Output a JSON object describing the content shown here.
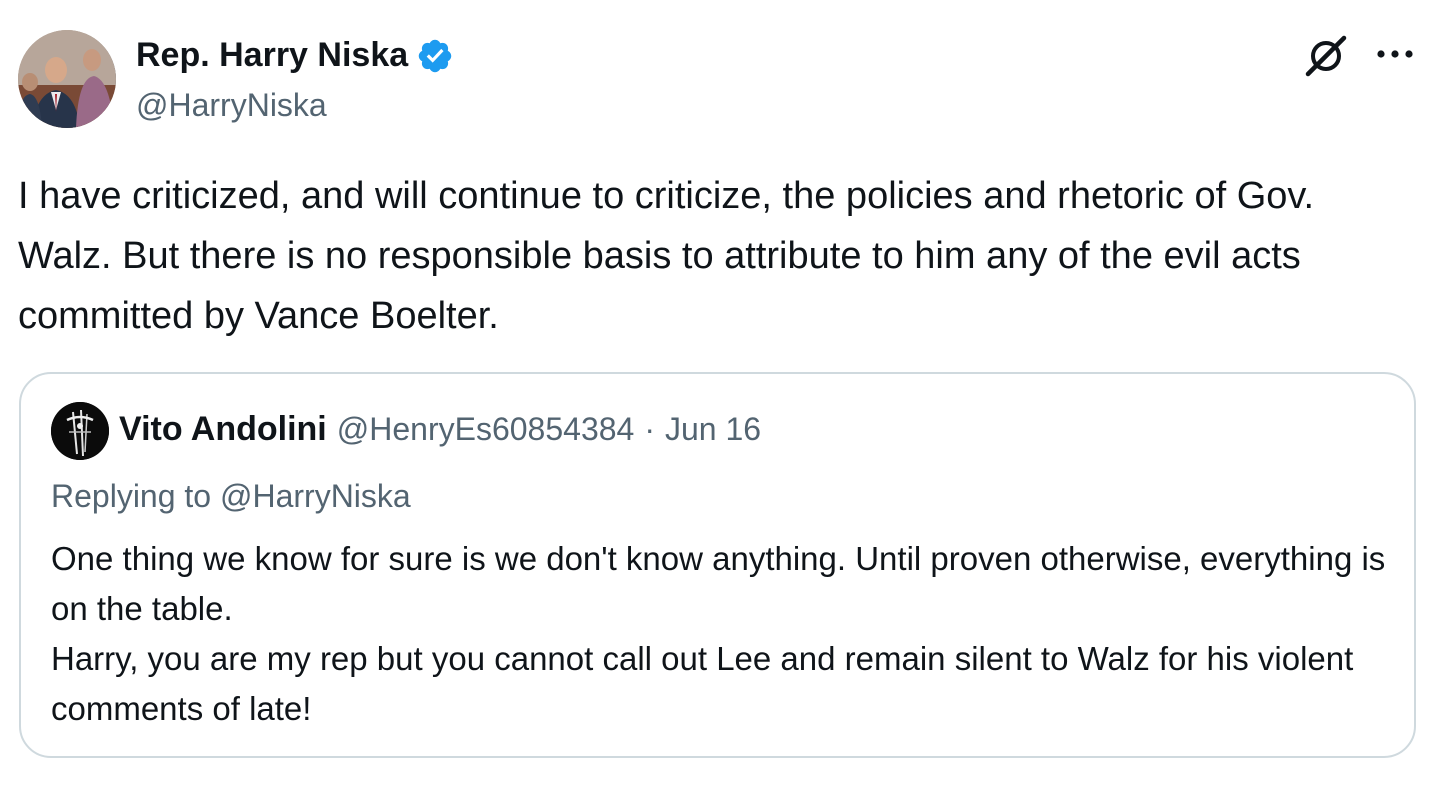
{
  "author": {
    "display_name": "Rep. Harry Niska",
    "handle": "@HarryNiska",
    "verified": true
  },
  "icons": {
    "verified": "verified-badge-icon",
    "grok": "grok-icon",
    "more": "more-options-icon"
  },
  "colors": {
    "verified_blue": "#1d9bf0",
    "secondary_text": "#536471",
    "border": "#cfd9de"
  },
  "tweet": {
    "text": "I have criticized, and will continue to criticize, the policies and rhetoric of Gov. Walz. But there is no responsible basis to attribute to him any of the evil acts committed by Vance Boelter."
  },
  "quote": {
    "display_name": "Vito Andolini",
    "handle": "@HenryEs60854384",
    "separator": "·",
    "date": "Jun 16",
    "replying_to": "Replying to @HarryNiska",
    "text_lines": [
      "One thing we know for sure is we don't know anything. Until proven otherwise, everything is on the table.",
      "Harry, you are my rep but you cannot call out Lee and remain silent to Walz for his violent comments of late!"
    ]
  }
}
